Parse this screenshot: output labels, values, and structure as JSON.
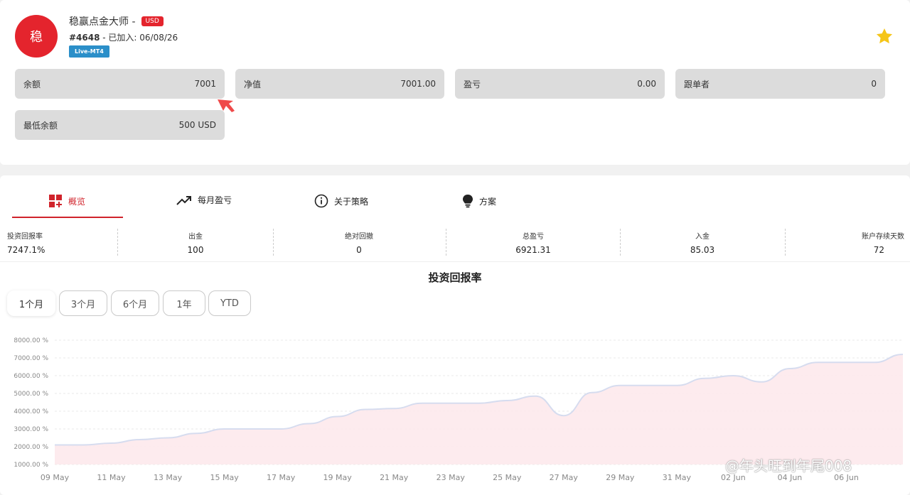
{
  "header": {
    "avatar_char": "稳",
    "title": "稳赢点金大师 -",
    "currency_badge": "USD",
    "account_number": "#4648",
    "joined_text": " - 已加入: 06/08/26",
    "platform_badge": "Live-MT4"
  },
  "stats": [
    {
      "label": "余额",
      "value": "7001"
    },
    {
      "label": "净值",
      "value": "7001.00"
    },
    {
      "label": "盈亏",
      "value": "0.00"
    },
    {
      "label": "跟单者",
      "value": "0"
    },
    {
      "label": "最低余额",
      "value": "500 USD"
    }
  ],
  "tabs": [
    {
      "label": "概览",
      "icon": "dashboard-icon"
    },
    {
      "label": "每月盈亏",
      "icon": "trend-up-icon"
    },
    {
      "label": "关于策略",
      "icon": "info-icon"
    },
    {
      "label": "方案",
      "icon": "lightbulb-icon"
    }
  ],
  "metrics": [
    {
      "label": "投资回报率",
      "value": "7247.1%"
    },
    {
      "label": "出金",
      "value": "100"
    },
    {
      "label": "绝对回撤",
      "value": "0"
    },
    {
      "label": "总盈亏",
      "value": "6921.31"
    },
    {
      "label": "入金",
      "value": "85.03"
    },
    {
      "label": "账户存续天数",
      "value": "72"
    }
  ],
  "chart_title": "投资回报率",
  "ranges": [
    "1个月",
    "3个月",
    "6个月",
    "1年",
    "YTD"
  ],
  "active_range": "1个月",
  "colors": {
    "accent": "#d0232b",
    "badge_blue": "#2b8fc9",
    "area_fill": "#fde9ec",
    "line": "#d6dcef"
  },
  "watermark": "@年头旺到年尾008",
  "chart_data": {
    "type": "area",
    "title": "投资回报率",
    "xlabel": "",
    "ylabel": "",
    "ylim": [
      1000,
      8000
    ],
    "y_ticks": [
      "8000.00 %",
      "7000.00 %",
      "6000.00 %",
      "5000.00 %",
      "4000.00 %",
      "3000.00 %",
      "2000.00 %",
      "1000.00 %"
    ],
    "x_ticks": [
      "09 May",
      "11 May",
      "13 May",
      "15 May",
      "17 May",
      "19 May",
      "21 May",
      "23 May",
      "25 May",
      "27 May",
      "29 May",
      "31 May",
      "02 Jun",
      "04 Jun",
      "06 Jun"
    ],
    "grid": true,
    "series": [
      {
        "x": [
          "09 May",
          "10 May",
          "11 May",
          "12 May",
          "13 May",
          "14 May",
          "15 May",
          "16 May",
          "17 May",
          "18 May",
          "19 May",
          "20 May",
          "21 May",
          "22 May",
          "23 May",
          "24 May",
          "25 May",
          "26 May",
          "27 May",
          "28 May",
          "29 May",
          "30 May",
          "31 May",
          "01 Jun",
          "02 Jun",
          "03 Jun",
          "04 Jun",
          "05 Jun",
          "06 Jun",
          "07 Jun",
          "08 Jun"
        ],
        "values": [
          2100,
          2100,
          2200,
          2400,
          2500,
          2750,
          3000,
          3000,
          3000,
          3300,
          3700,
          4100,
          4150,
          4450,
          4450,
          4450,
          4600,
          4850,
          3750,
          5050,
          5450,
          5450,
          5450,
          5850,
          6000,
          5650,
          6400,
          6750,
          6750,
          6750,
          7200
        ]
      }
    ]
  }
}
